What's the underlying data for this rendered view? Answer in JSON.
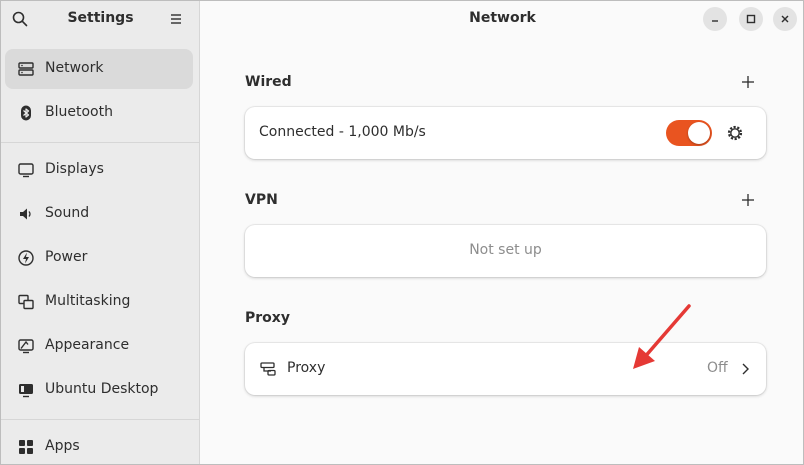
{
  "sidebar": {
    "title": "Settings",
    "items": [
      {
        "label": "Network",
        "icon": "network-icon"
      },
      {
        "label": "Bluetooth",
        "icon": "bluetooth-icon"
      },
      {
        "label": "Displays",
        "icon": "display-icon"
      },
      {
        "label": "Sound",
        "icon": "sound-icon"
      },
      {
        "label": "Power",
        "icon": "power-icon"
      },
      {
        "label": "Multitasking",
        "icon": "multitasking-icon"
      },
      {
        "label": "Appearance",
        "icon": "appearance-icon"
      },
      {
        "label": "Ubuntu Desktop",
        "icon": "ubuntu-desktop-icon"
      },
      {
        "label": "Apps",
        "icon": "apps-icon"
      }
    ]
  },
  "main": {
    "title": "Network",
    "wired": {
      "heading": "Wired",
      "status": "Connected - 1,000 Mb/s",
      "toggle_on": true
    },
    "vpn": {
      "heading": "VPN",
      "status": "Not set up"
    },
    "proxy": {
      "heading": "Proxy",
      "row_label": "Proxy",
      "row_value": "Off"
    }
  },
  "colors": {
    "accent": "#e95420",
    "annotation_arrow": "#e53935"
  }
}
